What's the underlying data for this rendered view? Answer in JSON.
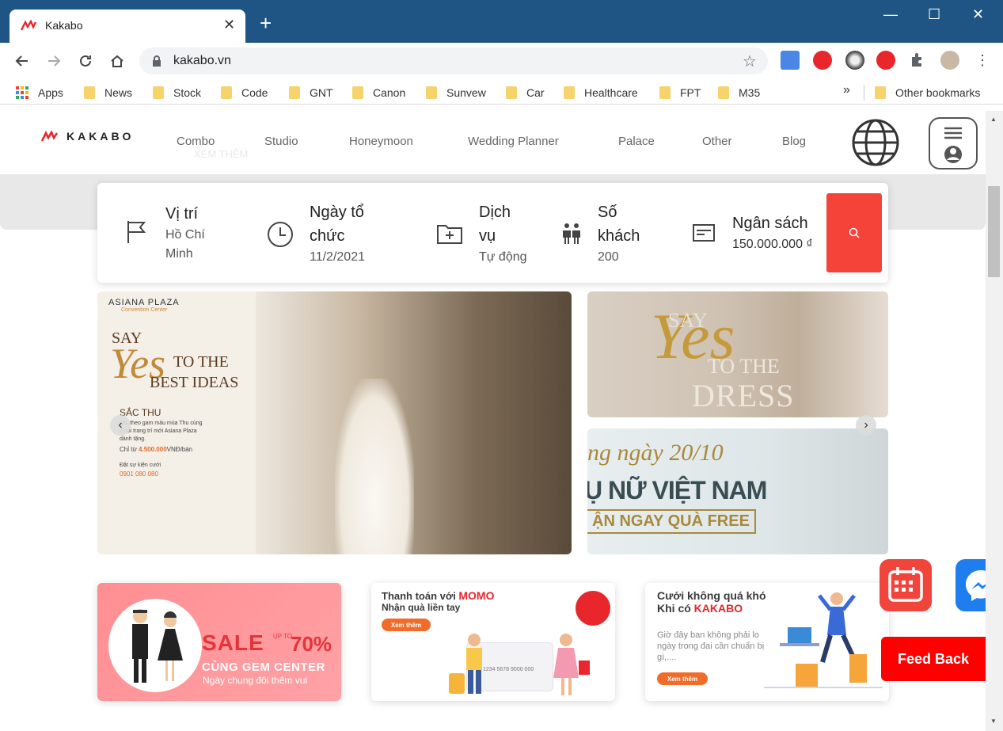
{
  "browser": {
    "tab_title": "Kakabo",
    "url": "kakabo.vn",
    "bookmarks": [
      {
        "label": "Apps"
      },
      {
        "label": "News"
      },
      {
        "label": "Stock"
      },
      {
        "label": "Code"
      },
      {
        "label": "GNT"
      },
      {
        "label": "Canon"
      },
      {
        "label": "Sunvew"
      },
      {
        "label": "Car"
      },
      {
        "label": "Healthcare"
      },
      {
        "label": "FPT"
      },
      {
        "label": "M35"
      }
    ],
    "bookmarks_overflow": "»",
    "other_bookmarks": "Other bookmarks"
  },
  "site": {
    "brand": "KAKABO",
    "nav": [
      "Combo",
      "Studio",
      "Honeymoon",
      "Wedding Planner",
      "Palace",
      "Other",
      "Blog"
    ],
    "ghost_text": "XEM THÊM"
  },
  "search": {
    "location": {
      "label": "Vị trí",
      "value": "Hồ Chí Minh"
    },
    "date": {
      "label": "Ngày tổ chức",
      "value": "11/2/2021"
    },
    "service": {
      "label": "Dịch vụ",
      "value": "Tự động"
    },
    "guests": {
      "label": "Số khách",
      "value": "200"
    },
    "budget": {
      "label": "Ngân sách",
      "value": "150.000.000 ₫"
    }
  },
  "hero": {
    "venue": "ASIANA PLAZA",
    "venue_sub": "Convention Center",
    "say": "SAY",
    "yes": "Yes",
    "to_the": "TO THE",
    "best_ideas": "BEST IDEAS",
    "collection": "SẮC THU",
    "desc": "Lạc theo gam màu mùa Thu cùng 3 gói trang trí mới Asiana Plaza dành tặng.",
    "price_prefix": "Chỉ từ",
    "price": "4.500.000",
    "price_suffix": "VNĐ/bàn",
    "contact": "Đặt sự kiện cưới",
    "phone": "0901 080 080"
  },
  "dress": {
    "say": "SAY",
    "yes": "Yes",
    "to_the": "TO THE",
    "dress": "DRESS"
  },
  "women": {
    "day": "ng ngày 20/10",
    "title": "Ụ NỮ VIỆT NAM",
    "free": "ẬN NGAY QUÀ FREE"
  },
  "promos": {
    "sale": {
      "word": "SALE",
      "upto": "UP TO",
      "percent": "70%",
      "gem": "CÙNG GEM CENTER",
      "sub": "Ngày chung đôi thêm vui"
    },
    "momo": {
      "line1_prefix": "Thanh toán với",
      "line1_brand": "MOMO",
      "line2": "Nhận quà liền tay",
      "cta": "Xem thêm",
      "card_number": "1234 5678 9000 000"
    },
    "kakabo": {
      "line1": "Cưới không quá khó",
      "line2_prefix": "Khi có",
      "line2_brand": "KAKABO",
      "desc": "Giờ đây ban không phải lo ngày trong đai cần chuẩn bị gì,....",
      "cta": "Xem thêm"
    }
  },
  "floating": {
    "feedback": "Feed Back"
  },
  "colors": {
    "brand_red": "#f6433a",
    "chrome_blue": "#1f5585",
    "feedback_red": "#fe0000",
    "messenger_blue": "#1e7ef0"
  }
}
